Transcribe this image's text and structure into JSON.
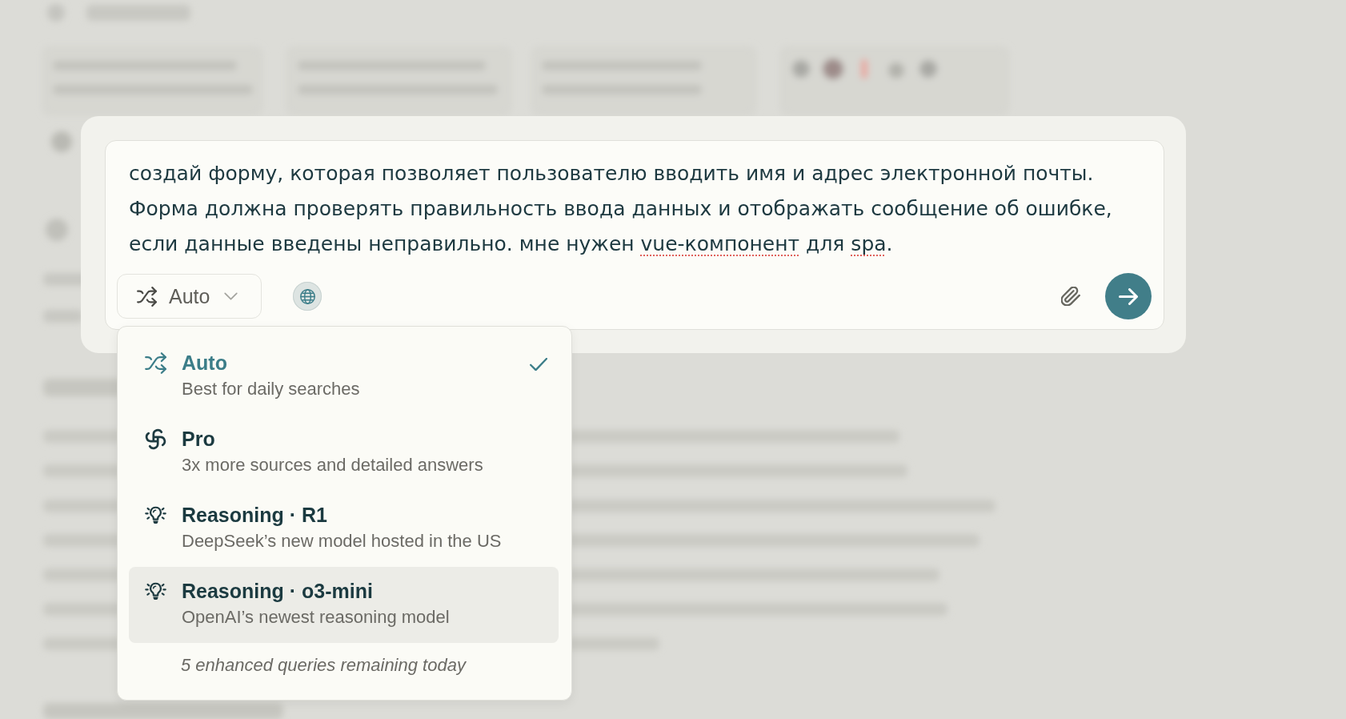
{
  "composer": {
    "prompt": [
      {
        "text": "создай форму, которая позволяет пользователю вводить имя и адрес электронной почты. Форма должна проверять правильность ввода данных и отображать сообщение об ошибке, если данные введены неправильно. мне нужен ",
        "misspelled": false
      },
      {
        "text": "vue-компонент",
        "misspelled": true
      },
      {
        "text": " для ",
        "misspelled": false
      },
      {
        "text": "spa",
        "misspelled": true
      },
      {
        "text": ".",
        "misspelled": false
      }
    ],
    "mode_button": {
      "label": "Auto"
    },
    "web_search": {
      "on": true
    }
  },
  "menu": {
    "open": true,
    "items": [
      {
        "kind": "auto",
        "title": "Auto",
        "description": "Best for daily searches",
        "selected": true,
        "hovered": false
      },
      {
        "kind": "pro",
        "title": "Pro",
        "description": "3x more sources and detailed answers",
        "selected": false,
        "hovered": false
      },
      {
        "kind": "reasoning",
        "title": "Reasoning · R1",
        "description": "DeepSeek’s new model hosted in the US",
        "selected": false,
        "hovered": false
      },
      {
        "kind": "reasoning",
        "title": "Reasoning · o3-mini",
        "description": "OpenAI’s newest reasoning model",
        "selected": false,
        "hovered": true
      }
    ],
    "footer": "5 enhanced queries remaining today"
  }
}
